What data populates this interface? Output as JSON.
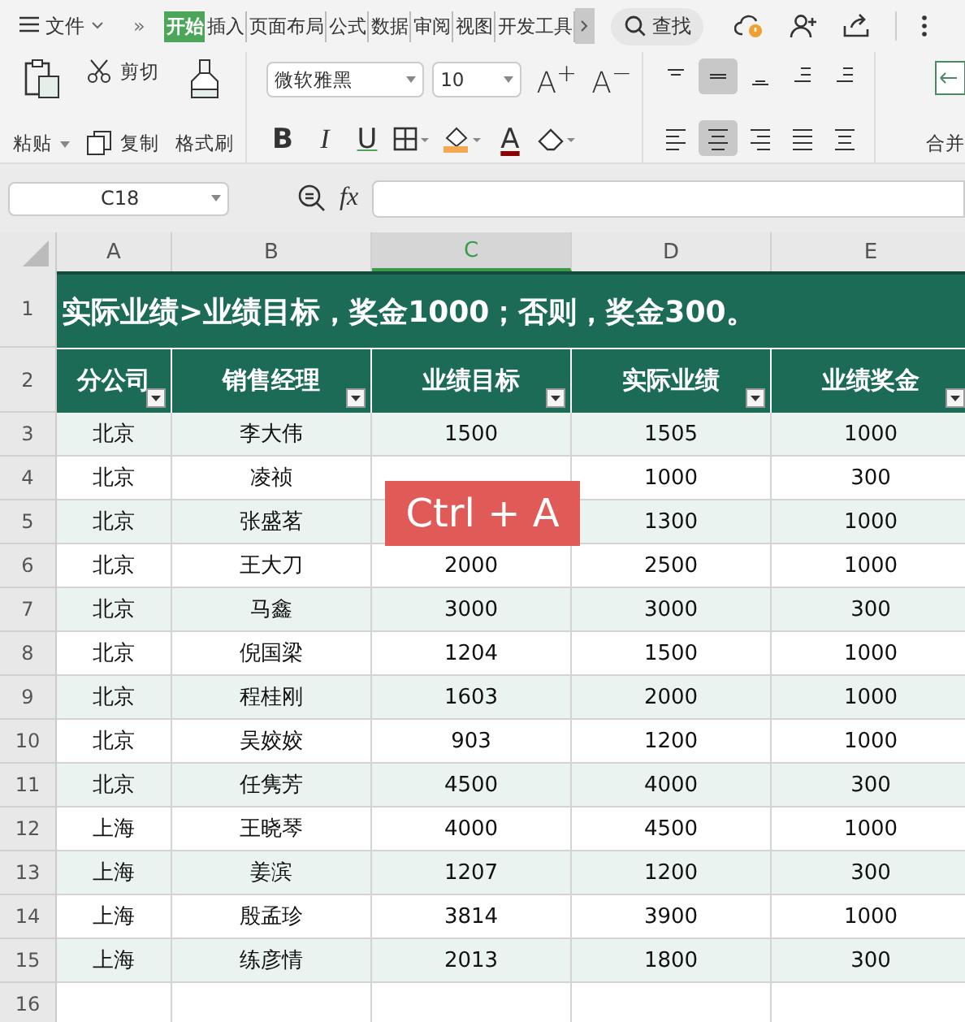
{
  "menu": {
    "file": "文件",
    "more": "»",
    "tabs": [
      {
        "label": "开始",
        "selected": true
      },
      {
        "label": "插入",
        "selected": false
      },
      {
        "label": "页面布局",
        "selected": false
      },
      {
        "label": "公式",
        "selected": false
      },
      {
        "label": "数据",
        "selected": false
      },
      {
        "label": "审阅",
        "selected": false
      },
      {
        "label": "视图",
        "selected": false
      },
      {
        "label": "开发工具",
        "selected": false
      }
    ],
    "search": "查找"
  },
  "ribbon": {
    "paste": "粘贴",
    "cut": "剪切",
    "copy": "复制",
    "format_painter": "格式刷",
    "font_name": "微软雅黑",
    "font_size": "10",
    "grow": "A$^{+}$",
    "shrink": "A$^{−}$",
    "bold": "B",
    "italic": "I",
    "underline": "U",
    "font_color": "A",
    "valign": [
      {
        "kind": "top",
        "selected": false
      },
      {
        "kind": "middle",
        "selected": true
      },
      {
        "kind": "bottom",
        "selected": false
      },
      {
        "kind": "outdent",
        "selected": false
      },
      {
        "kind": "indent",
        "selected": false
      }
    ],
    "halign": [
      {
        "kind": "left",
        "selected": false
      },
      {
        "kind": "center",
        "selected": true
      },
      {
        "kind": "right",
        "selected": false
      },
      {
        "kind": "justify",
        "selected": false
      },
      {
        "kind": "distributed",
        "selected": false
      }
    ],
    "merge": "合并"
  },
  "formula_bar": {
    "name_box": "C18",
    "fx": "fx"
  },
  "sheet": {
    "columns": [
      {
        "label": "A",
        "selected": false
      },
      {
        "label": "B",
        "selected": false
      },
      {
        "label": "C",
        "selected": true
      },
      {
        "label": "D",
        "selected": false
      },
      {
        "label": "E",
        "selected": false
      }
    ],
    "title": "实际业绩>业绩目标，奖金1000；否则，奖金300。",
    "headers": [
      "分公司",
      "销售经理",
      "业绩目标",
      "实际业绩",
      "业绩奖金"
    ],
    "rows": [
      [
        "北京",
        "李大伟",
        "1500",
        "1505",
        "1000"
      ],
      [
        "北京",
        "凌祯",
        null,
        "1000",
        "300"
      ],
      [
        "北京",
        "张盛茗",
        null,
        "1300",
        "1000"
      ],
      [
        "北京",
        "王大刀",
        "2000",
        "2500",
        "1000"
      ],
      [
        "北京",
        "马鑫",
        "3000",
        "3000",
        "300"
      ],
      [
        "北京",
        "倪国梁",
        "1204",
        "1500",
        "1000"
      ],
      [
        "北京",
        "程桂刚",
        "1603",
        "2000",
        "1000"
      ],
      [
        "北京",
        "吴姣姣",
        "903",
        "1200",
        "1000"
      ],
      [
        "北京",
        "任隽芳",
        "4500",
        "4000",
        "300"
      ],
      [
        "上海",
        "王晓琴",
        "4000",
        "4500",
        "1000"
      ],
      [
        "上海",
        "姜滨",
        "1207",
        "1200",
        "300"
      ],
      [
        "上海",
        "殷孟珍",
        "3814",
        "3900",
        "1000"
      ],
      [
        "上海",
        "练彦情",
        "2013",
        "1800",
        "300"
      ]
    ],
    "row_numbers": [
      "1",
      "2",
      "3",
      "4",
      "5",
      "6",
      "7",
      "8",
      "9",
      "10",
      "11",
      "12",
      "13",
      "14",
      "15",
      "16"
    ]
  },
  "keystroke": "Ctrl + A"
}
